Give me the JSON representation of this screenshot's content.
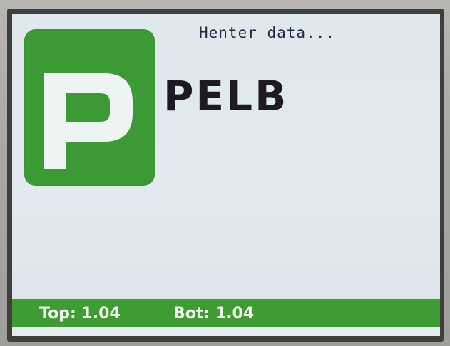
{
  "screen": {
    "status_message": "Henter data...",
    "brand_name": "PELB",
    "logo_letter": "P"
  },
  "status_bar": {
    "top_readout": "Top: 1.04",
    "bot_readout": "Bot: 1.04"
  },
  "colors": {
    "logo_green": "#3c9a35",
    "bar_green": "#3f9c32",
    "screen_bg": "#e0e8ed",
    "brand_text": "#1d1a22"
  }
}
